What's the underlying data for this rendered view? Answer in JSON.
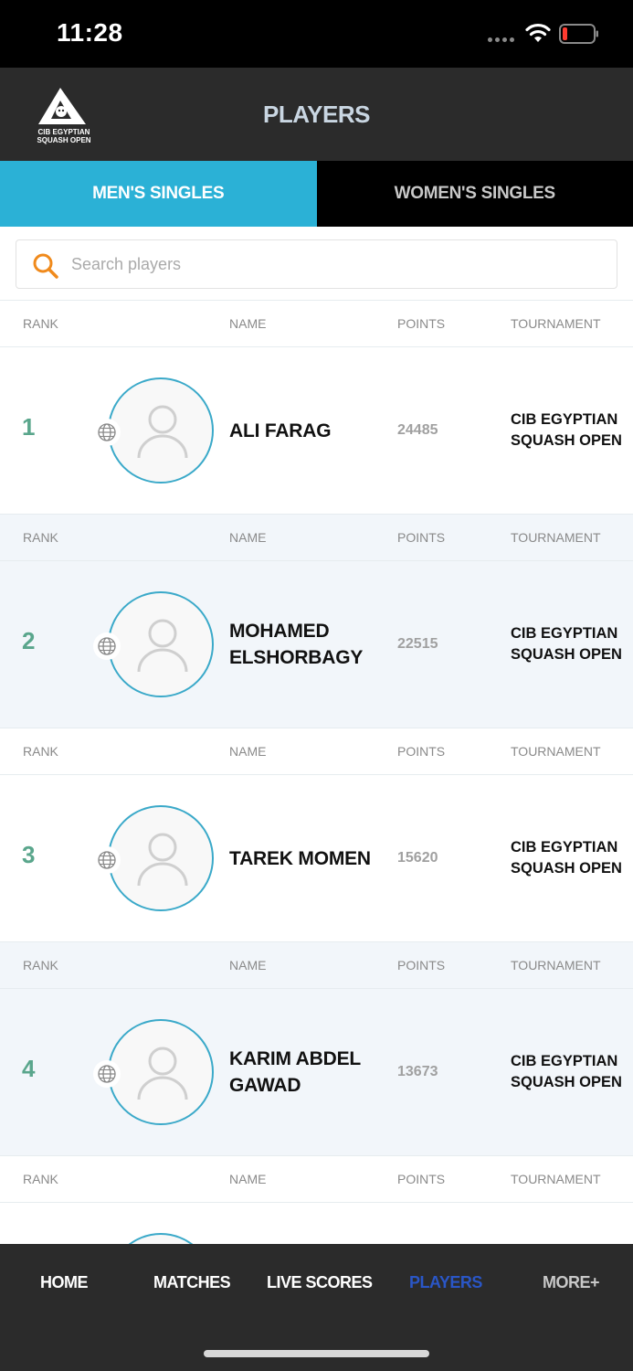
{
  "status_bar": {
    "time": "11:28"
  },
  "header": {
    "logo_text_line1": "EGYPTIAN",
    "logo_text_line2": "SQUASH OPEN",
    "logo_brand": "CIB",
    "title": "PLAYERS"
  },
  "tabs": [
    {
      "label": "MEN'S SINGLES",
      "active": true
    },
    {
      "label": "WOMEN'S SINGLES",
      "active": false
    }
  ],
  "search": {
    "placeholder": "Search players",
    "value": ""
  },
  "columns": {
    "rank": "RANK",
    "name": "NAME",
    "points": "POINTS",
    "tournament": "TOURNAMENT"
  },
  "players": [
    {
      "rank": "1",
      "name": "ALI FARAG",
      "points": "24485",
      "tournament": "CIB EGYPTIAN SQUASH OPEN"
    },
    {
      "rank": "2",
      "name": "MOHAMED ELSHORBAGY",
      "points": "22515",
      "tournament": "CIB EGYPTIAN SQUASH OPEN"
    },
    {
      "rank": "3",
      "name": "TAREK MOMEN",
      "points": "15620",
      "tournament": "CIB EGYPTIAN SQUASH OPEN"
    },
    {
      "rank": "4",
      "name": "KARIM ABDEL GAWAD",
      "points": "13673",
      "tournament": "CIB EGYPTIAN SQUASH OPEN"
    }
  ],
  "bottom_nav": [
    {
      "label": "HOME",
      "active": false
    },
    {
      "label": "MATCHES",
      "active": false
    },
    {
      "label": "LIVE SCORES",
      "active": false
    },
    {
      "label": "PLAYERS",
      "active": true
    },
    {
      "label": "MORE+",
      "active": false
    }
  ],
  "colors": {
    "accent": "#2bb1d6",
    "rank": "#5aa68c",
    "nav_active": "#2a56c6",
    "header_bg": "#2b2b2b"
  },
  "icons": [
    "wifi-icon",
    "battery-icon",
    "search-icon",
    "globe-icon",
    "user-avatar-icon"
  ]
}
